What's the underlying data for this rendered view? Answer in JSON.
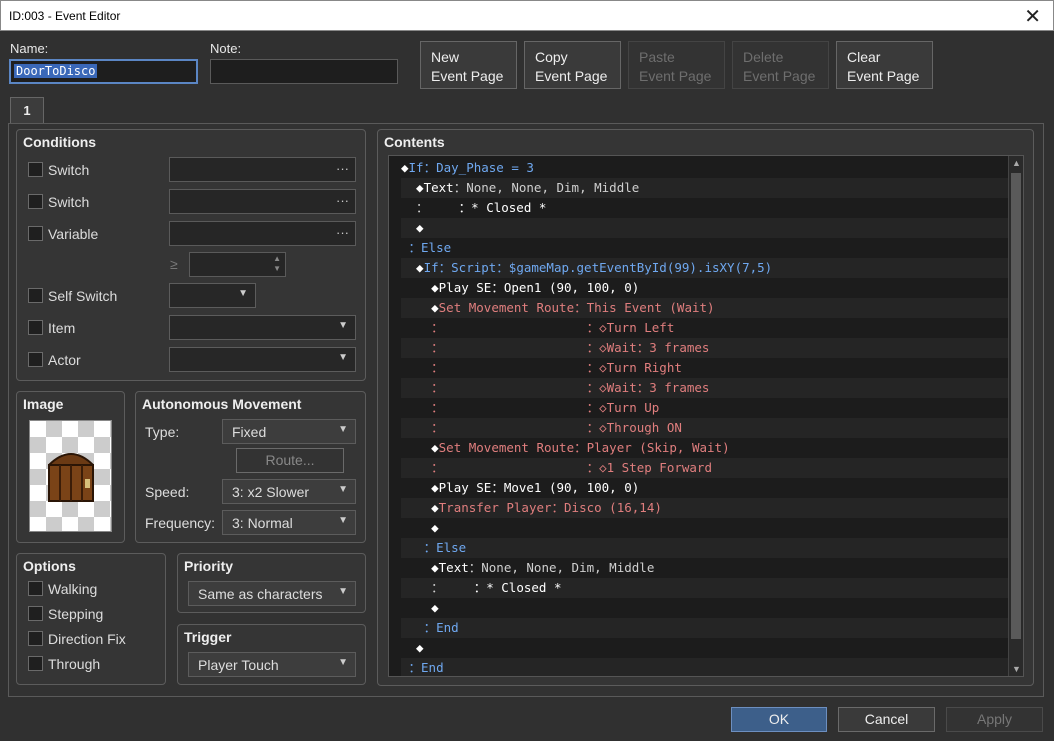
{
  "window": {
    "title": "ID:003 - Event Editor",
    "close": "✕"
  },
  "form": {
    "name_label": "Name:",
    "name_value": "DoorToDisco",
    "note_label": "Note:",
    "note_value": ""
  },
  "page_buttons": [
    {
      "line1": "New",
      "line2": "Event Page",
      "enabled": true
    },
    {
      "line1": "Copy",
      "line2": "Event Page",
      "enabled": true
    },
    {
      "line1": "Paste",
      "line2": "Event Page",
      "enabled": false
    },
    {
      "line1": "Delete",
      "line2": "Event Page",
      "enabled": false
    },
    {
      "line1": "Clear",
      "line2": "Event Page",
      "enabled": true
    }
  ],
  "tab": {
    "label": "1"
  },
  "conditions": {
    "title": "Conditions",
    "switch1": "Switch",
    "switch2": "Switch",
    "variable": "Variable",
    "ge": "≥",
    "self_switch": "Self Switch",
    "item": "Item",
    "actor": "Actor",
    "dots": "···"
  },
  "image": {
    "title": "Image"
  },
  "autonomous": {
    "title": "Autonomous Movement",
    "type_label": "Type:",
    "type_value": "Fixed",
    "route_button": "Route...",
    "speed_label": "Speed:",
    "speed_value": "3: x2 Slower",
    "freq_label": "Frequency:",
    "freq_value": "3: Normal"
  },
  "options": {
    "title": "Options",
    "walking": "Walking",
    "stepping": "Stepping",
    "direction_fix": "Direction Fix",
    "through": "Through"
  },
  "priority": {
    "title": "Priority",
    "value": "Same as characters"
  },
  "trigger": {
    "title": "Trigger",
    "value": "Player Touch"
  },
  "contents": {
    "title": "Contents",
    "lines": [
      [
        [
          "◆",
          "#fff"
        ],
        [
          "If",
          "#6fa8f0"
        ],
        [
          "：Day_Phase = 3",
          "#6fa8f0"
        ]
      ],
      [
        [
          "  ◆",
          "#fff"
        ],
        [
          "Text",
          "#fff"
        ],
        [
          "：None, None, Dim, Middle",
          "#cfcfcf"
        ]
      ],
      [
        [
          "  ：    ",
          "#cfcfcf"
        ],
        [
          "：* Closed *",
          "#fff"
        ]
      ],
      [
        [
          "  ◆",
          "#fff"
        ]
      ],
      [
        [
          " ：Else",
          "#6fa8f0"
        ]
      ],
      [
        [
          "  ◆",
          "#fff"
        ],
        [
          "If",
          "#6fa8f0"
        ],
        [
          "：Script：$gameMap.getEventById(99).isXY(7,5)",
          "#6fa8f0"
        ]
      ],
      [
        [
          "    ◆",
          "#fff"
        ],
        [
          "Play SE",
          "#fff"
        ],
        [
          "：Open1 (90, 100, 0)",
          "#fff"
        ]
      ],
      [
        [
          "    ◆",
          "#fff"
        ],
        [
          "Set Movement Route",
          "#e07e7e"
        ],
        [
          "：This Event (Wait)",
          "#e07e7e"
        ]
      ],
      [
        [
          "    ：                   ：",
          "#e07e7e"
        ],
        [
          "◇Turn Left",
          "#e07e7e"
        ]
      ],
      [
        [
          "    ：                   ：",
          "#e07e7e"
        ],
        [
          "◇Wait：3 frames",
          "#e07e7e"
        ]
      ],
      [
        [
          "    ：                   ：",
          "#e07e7e"
        ],
        [
          "◇Turn Right",
          "#e07e7e"
        ]
      ],
      [
        [
          "    ：                   ：",
          "#e07e7e"
        ],
        [
          "◇Wait：3 frames",
          "#e07e7e"
        ]
      ],
      [
        [
          "    ：                   ：",
          "#e07e7e"
        ],
        [
          "◇Turn Up",
          "#e07e7e"
        ]
      ],
      [
        [
          "    ：                   ：",
          "#e07e7e"
        ],
        [
          "◇Through ON",
          "#e07e7e"
        ]
      ],
      [
        [
          "    ◆",
          "#fff"
        ],
        [
          "Set Movement Route",
          "#e07e7e"
        ],
        [
          "：Player (Skip, Wait)",
          "#e07e7e"
        ]
      ],
      [
        [
          "    ：                   ：",
          "#e07e7e"
        ],
        [
          "◇1 Step Forward",
          "#e07e7e"
        ]
      ],
      [
        [
          "    ◆",
          "#fff"
        ],
        [
          "Play SE",
          "#fff"
        ],
        [
          "：Move1 (90, 100, 0)",
          "#fff"
        ]
      ],
      [
        [
          "    ◆",
          "#fff"
        ],
        [
          "Transfer Player",
          "#e07e7e"
        ],
        [
          "：Disco (16,14)",
          "#e07e7e"
        ]
      ],
      [
        [
          "    ◆",
          "#fff"
        ]
      ],
      [
        [
          "   ：Else",
          "#6fa8f0"
        ]
      ],
      [
        [
          "    ◆",
          "#fff"
        ],
        [
          "Text",
          "#fff"
        ],
        [
          "：None, None, Dim, Middle",
          "#cfcfcf"
        ]
      ],
      [
        [
          "    ：    ",
          "#cfcfcf"
        ],
        [
          "：* Closed *",
          "#fff"
        ]
      ],
      [
        [
          "    ◆",
          "#fff"
        ]
      ],
      [
        [
          "   ：End",
          "#6fa8f0"
        ]
      ],
      [
        [
          "  ◆",
          "#fff"
        ]
      ],
      [
        [
          " ：End",
          "#6fa8f0"
        ]
      ]
    ]
  },
  "footer": {
    "ok": "OK",
    "cancel": "Cancel",
    "apply": "Apply"
  }
}
